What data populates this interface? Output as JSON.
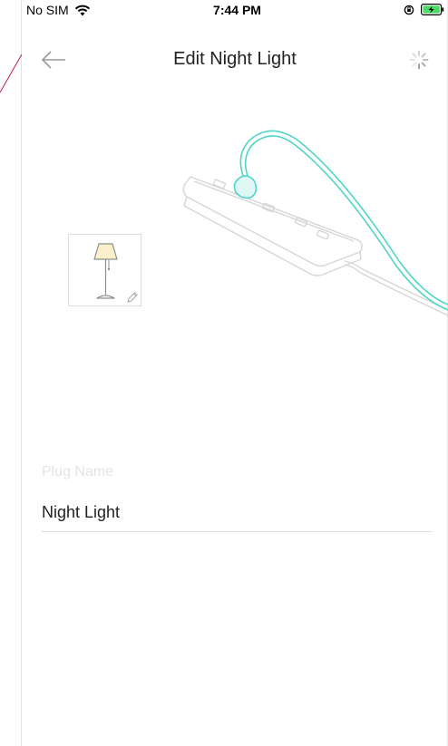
{
  "status_bar": {
    "carrier": "No SIM",
    "time": "7:44 PM",
    "icons": [
      "wifi-icon",
      "rotation-lock-icon",
      "battery-charging-icon"
    ]
  },
  "nav": {
    "title": "Edit Night Light",
    "back_icon": "back-arrow-icon",
    "action_icon": "loading-spinner-icon"
  },
  "device": {
    "icon": "lamp-icon",
    "edit_icon": "pencil-icon"
  },
  "form": {
    "label": "Plug Name",
    "value": "Night Light"
  },
  "colors": {
    "accent": "#4fd6c8",
    "device_outline": "#d6d6d6",
    "lamp_shade": "#fbeeca"
  }
}
